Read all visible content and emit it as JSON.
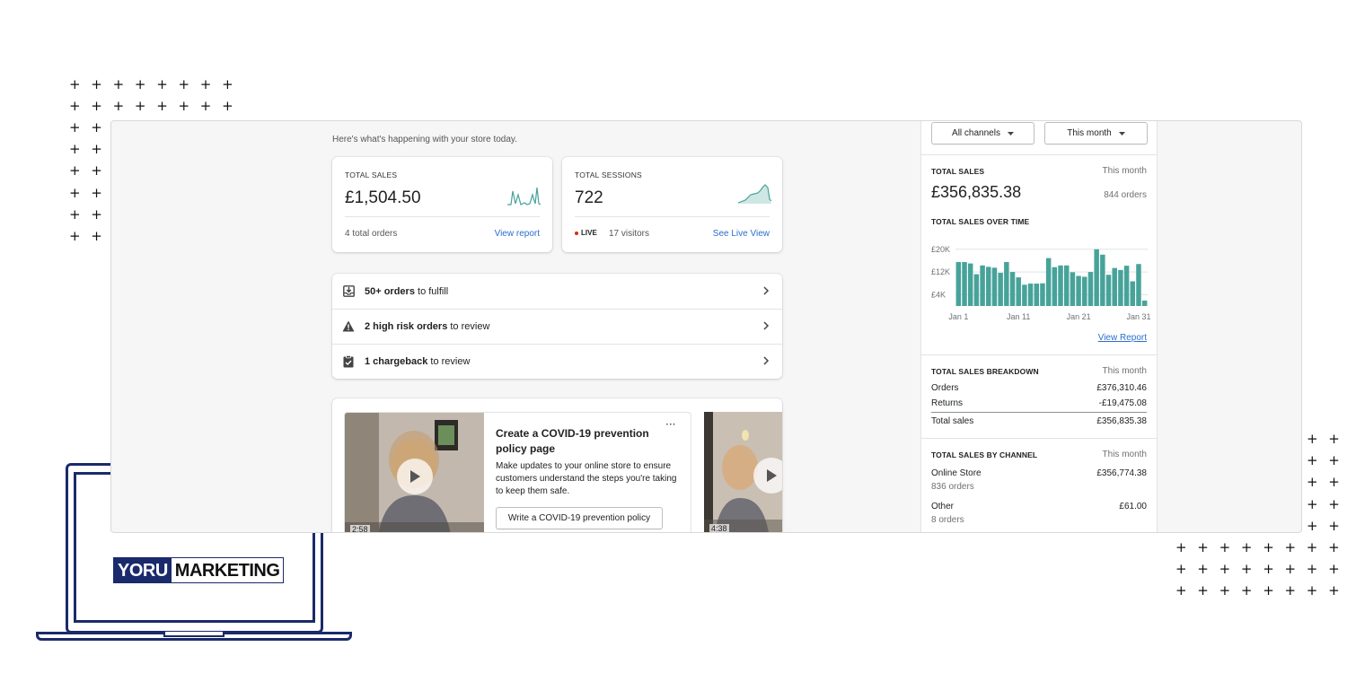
{
  "decor": {
    "plus_glyph": "+",
    "logo_left": "YORU",
    "logo_right": "MARKETING"
  },
  "main": {
    "subtitle": "Here's what's happening with your store today.",
    "sales_card": {
      "label": "TOTAL SALES",
      "value": "£1,504.50",
      "footer": "4 total orders",
      "link": "View report"
    },
    "sessions_card": {
      "label": "TOTAL SESSIONS",
      "value": "722",
      "live_badge": "LIVE",
      "visitors": "17 visitors",
      "link": "See Live View"
    },
    "tasks": [
      {
        "bold": "50+ orders",
        "rest": " to fulfill",
        "icon": "inbox-download-icon"
      },
      {
        "bold": "2 high risk orders",
        "rest": " to review",
        "icon": "warning-icon"
      },
      {
        "bold": "1 chargeback",
        "rest": " to review",
        "icon": "clipboard-icon"
      }
    ],
    "covid_card": {
      "title": "Create a COVID-19 prevention policy page",
      "body": "Make updates to your online store to ensure customers understand the steps you're taking to keep them safe.",
      "button": "Write a COVID-19 prevention policy",
      "more": "···",
      "video1_duration": "2:58",
      "video2_duration": "4:38"
    }
  },
  "panel": {
    "channels_button": "All channels",
    "period_button": "This month",
    "total_sales_label": "TOTAL SALES",
    "total_sales_period": "This month",
    "total_sales_value": "£356,835.38",
    "total_orders": "844 orders",
    "over_time_label": "TOTAL SALES OVER TIME",
    "view_report": "View Report",
    "breakdown_label": "TOTAL SALES BREAKDOWN",
    "breakdown_period": "This month",
    "breakdown": [
      {
        "name": "Orders",
        "value": "£376,310.46"
      },
      {
        "name": "Returns",
        "value": "-£19,475.08"
      },
      {
        "name": "Total sales",
        "value": "£356,835.38"
      }
    ],
    "channel_label": "TOTAL SALES BY CHANNEL",
    "channel_period": "This month",
    "channels": [
      {
        "name": "Online Store",
        "orders": "836 orders",
        "value": "£356,774.38"
      },
      {
        "name": "Other",
        "orders": "8 orders",
        "value": "£61.00"
      }
    ]
  },
  "chart_data": {
    "type": "bar",
    "title": "TOTAL SALES OVER TIME",
    "y_ticks": [
      "£20K",
      "£12K",
      "£4K"
    ],
    "x_ticks": [
      "Jan 1",
      "Jan 11",
      "Jan 21",
      "Jan 31"
    ],
    "color": "#47a39a",
    "ylim": [
      0,
      25000
    ],
    "values": [
      15500,
      15500,
      15000,
      11200,
      14300,
      13800,
      13500,
      11700,
      15500,
      12000,
      10100,
      7500,
      7900,
      7900,
      8000,
      16900,
      13700,
      14300,
      14300,
      11900,
      10600,
      10300,
      12000,
      20000,
      18100,
      11000,
      13400,
      12700,
      14200,
      8700,
      14800,
      1900
    ]
  }
}
